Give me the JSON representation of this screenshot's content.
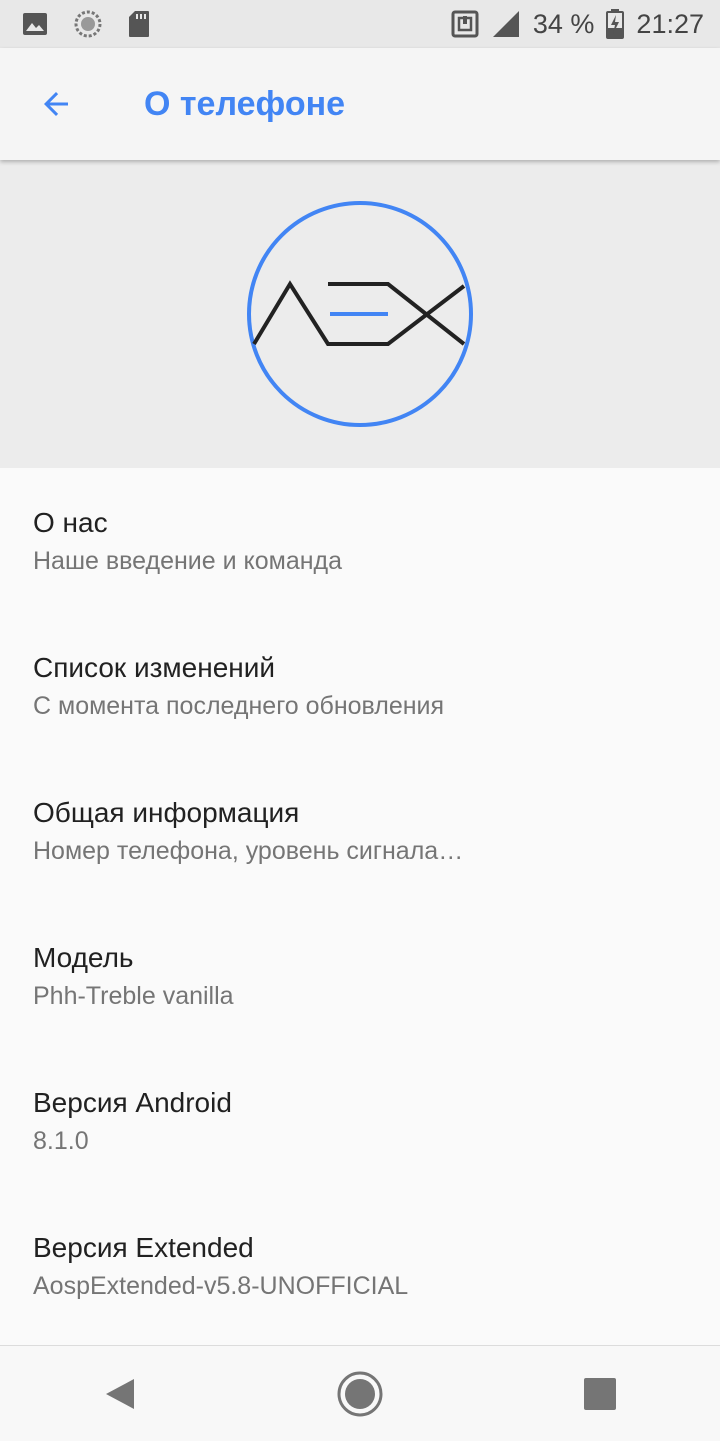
{
  "status_bar": {
    "battery": "34 %",
    "time": "21:27",
    "icons": [
      "image-icon",
      "sync-icon",
      "sd-card-icon",
      "nfc-icon",
      "signal-icon",
      "battery-charging-icon"
    ]
  },
  "toolbar": {
    "title": "О телефоне",
    "back_icon": "arrow-back-icon",
    "accent_color": "#4285f4"
  },
  "header": {
    "logo": "aex-logo",
    "logo_ring_color": "#4285f4"
  },
  "items": [
    {
      "title": "О нас",
      "subtitle": "Наше введение и команда"
    },
    {
      "title": "Список изменений",
      "subtitle": "С момента последнего обновления"
    },
    {
      "title": "Общая информация",
      "subtitle": "Номер телефона, уровень сигнала…"
    },
    {
      "title": "Модель",
      "subtitle": "Phh-Treble vanilla"
    },
    {
      "title": "Версия Android",
      "subtitle": "8.1.0"
    },
    {
      "title": "Версия Extended",
      "subtitle": "AospExtended-v5.8-UNOFFICIAL"
    }
  ],
  "nav_bar": {
    "icons": [
      "back-triangle-icon",
      "home-circle-icon",
      "recents-square-icon"
    ]
  }
}
